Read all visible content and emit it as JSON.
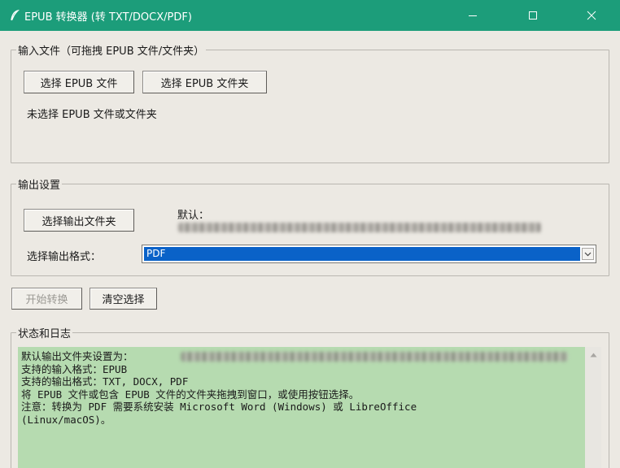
{
  "window": {
    "title": "EPUB 转换器 (转 TXT/DOCX/PDF)",
    "accent_color": "#1c9d7a",
    "title_icon": "feather-icon"
  },
  "input_group": {
    "label": "输入文件（可拖拽 EPUB 文件/文件夹）",
    "select_file_button": "选择 EPUB 文件",
    "select_folder_button": "选择 EPUB 文件夹",
    "status_text": "未选择 EPUB 文件或文件夹"
  },
  "output_group": {
    "label": "输出设置",
    "select_output_button": "选择输出文件夹",
    "default_label": "默认：",
    "format_label": "选择输出格式：",
    "format_selected": "PDF"
  },
  "actions": {
    "start_button": "开始转换",
    "clear_button": "清空选择"
  },
  "log_group": {
    "label": "状态和日志",
    "lines": [
      "默认输出文件夹设置为：",
      "支持的输入格式：EPUB",
      "支持的输出格式：TXT, DOCX, PDF",
      "将 EPUB 文件或包含 EPUB 文件的文件夹拖拽到窗口，或使用按钮选择。",
      "注意：转换为 PDF 需要系统安装 Microsoft Word (Windows) 或 LibreOffice",
      "(Linux/macOS)。"
    ]
  }
}
